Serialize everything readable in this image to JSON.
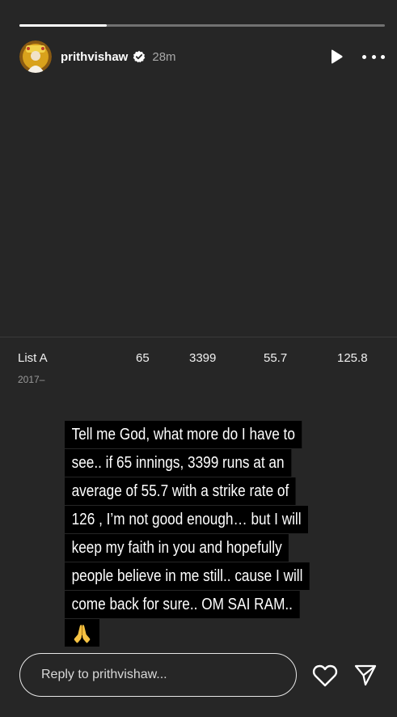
{
  "story": {
    "progress_fraction": 0.24,
    "username": "prithvishaw",
    "time_ago": "28m",
    "icons": {
      "verified": "verified-badge-icon",
      "play": "play-icon",
      "more": "more-options-icon",
      "heart": "heart-icon",
      "send": "send-icon"
    }
  },
  "stats": {
    "format": "List A",
    "years": "2017–",
    "innings": "65",
    "runs": "3399",
    "average": "55.7",
    "strike_rate": "125.8"
  },
  "caption": {
    "lines": [
      "Tell me God, what more do I have to",
      "see.. if 65 innings, 3399 runs at an",
      "average of 55.7 with a strike rate of",
      "126 , I’m not good enough… but I will",
      "keep my faith in you and hopefully",
      "people believe in me still.. cause I will",
      "come back for sure.. OM SAI RAM.."
    ],
    "emoji": "🙏"
  },
  "reply": {
    "placeholder": "Reply to prithvishaw..."
  },
  "colors": {
    "background": "#262626",
    "caption_bg": "#000000",
    "text": "#ffffff",
    "muted": "#a8a8a8"
  }
}
